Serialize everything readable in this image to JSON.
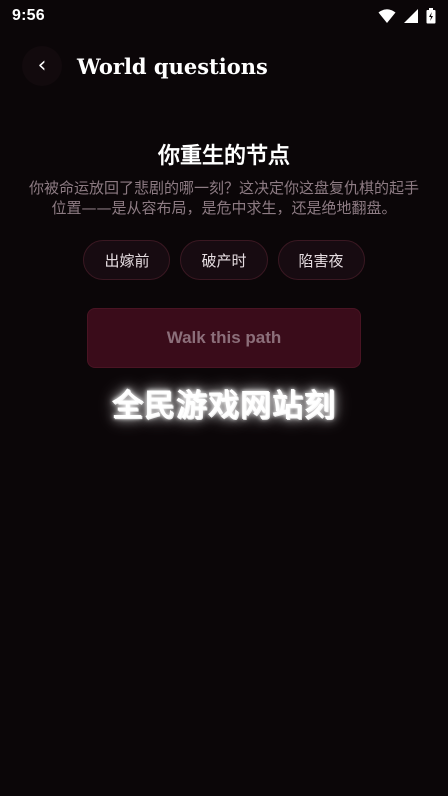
{
  "status_bar": {
    "time": "9:56",
    "icons": [
      "wifi-icon",
      "signal-icon",
      "battery-icon"
    ]
  },
  "app_bar": {
    "back_icon": "chevron-left-icon",
    "back_glyph": "‹",
    "title": "World questions"
  },
  "question": {
    "title": "你重生的节点",
    "description": "你被命运放回了悲剧的哪一刻？这决定你这盘复仇棋的起手位置——是从容布局，是危中求生，还是绝地翻盘。",
    "options": [
      {
        "label": "出嫁前"
      },
      {
        "label": "破产时"
      },
      {
        "label": "陷害夜"
      }
    ]
  },
  "primary_button": {
    "label": "Walk this path",
    "enabled": false
  },
  "watermark": {
    "text": "全民游戏网站刻"
  },
  "colors": {
    "background": "#0b0608",
    "chip_background": "#170b11",
    "chip_border": "#3a1822",
    "button_background": "#3a0c1a",
    "button_text": "#8c6f7a",
    "description_text": "#8d7b83"
  }
}
